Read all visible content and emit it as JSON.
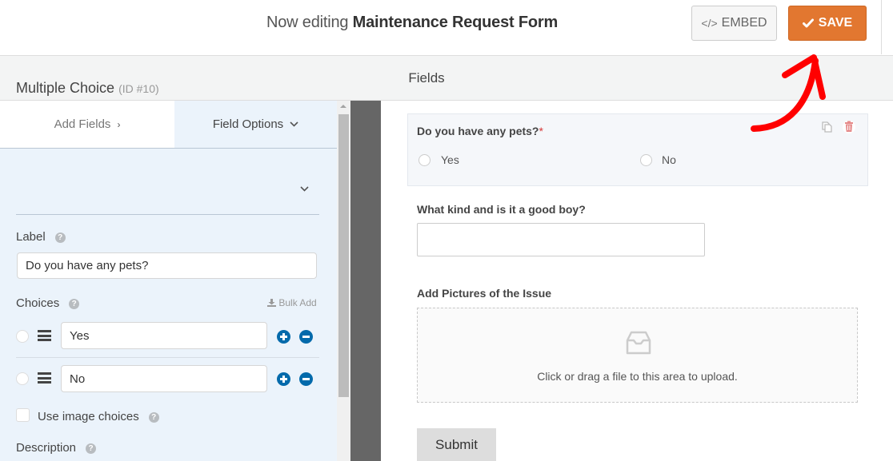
{
  "header": {
    "title_prefix": "Now editing",
    "form_name": "Maintenance Request Form",
    "embed_label": "EMBED",
    "embed_icon": "code-icon",
    "save_label": "SAVE",
    "save_icon": "checkmark-icon",
    "accent_color": "#e27730"
  },
  "section": {
    "title": "Fields"
  },
  "left_panel": {
    "tabs": [
      {
        "label": "Add Fields",
        "icon": "chevron-right-icon",
        "active": false
      },
      {
        "label": "Field Options",
        "icon": "chevron-down-icon",
        "active": true
      }
    ],
    "field_type": "Multiple Choice",
    "field_id": "(ID #10)",
    "label_heading": "Label",
    "label_value": "Do you have any pets?",
    "choices_heading": "Choices",
    "bulk_add_label": "Bulk Add",
    "choices": [
      {
        "value": "Yes"
      },
      {
        "value": "No"
      }
    ],
    "image_choices_label": "Use image choices",
    "image_choices_checked": false,
    "description_heading": "Description"
  },
  "preview": {
    "fields": [
      {
        "label": "Do you have any pets?",
        "required_marker": "*",
        "options": [
          "Yes",
          "No"
        ]
      },
      {
        "label": "What kind and is it a good boy?",
        "value": ""
      },
      {
        "label": "Add Pictures of the Issue",
        "upload_text": "Click or drag a file to this area to upload."
      }
    ],
    "submit_label": "Submit"
  }
}
